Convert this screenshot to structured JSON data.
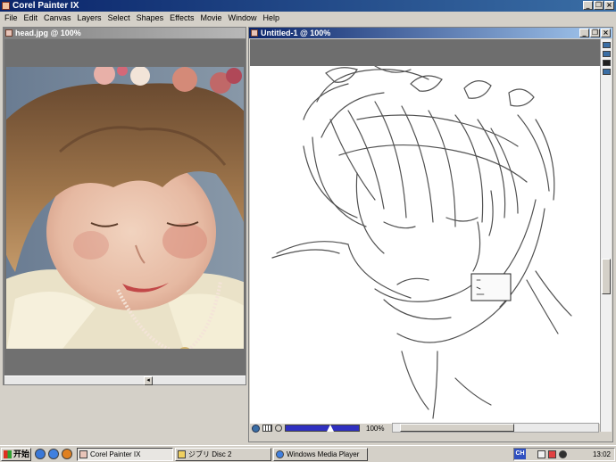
{
  "app": {
    "title": "Corel Painter IX"
  },
  "menu": [
    "File",
    "Edit",
    "Canvas",
    "Layers",
    "Select",
    "Shapes",
    "Effects",
    "Movie",
    "Window",
    "Help"
  ],
  "window_controls": {
    "minimize": "_",
    "restore": "❐",
    "close": "×"
  },
  "doc1": {
    "title": "head.jpg @ 100%",
    "scroll_arrow": "◂"
  },
  "doc2": {
    "title": "Untitled-1 @ 100%",
    "zoom_label": "100%"
  },
  "taskbar": {
    "start_label": "开始",
    "tasks": [
      {
        "label": "Corel Painter IX"
      },
      {
        "label": "ジブリ Disc 2"
      },
      {
        "label": "Windows Media Player"
      }
    ],
    "ime_label": "CH",
    "clock": "13:02"
  },
  "colors": {
    "title_active_start": "#0a246a",
    "title_active_end": "#a6caf0",
    "face_chrome": "#d4d0c8",
    "canvas_gray": "#6e6e6e",
    "zoom_bar": "#3030c0"
  }
}
